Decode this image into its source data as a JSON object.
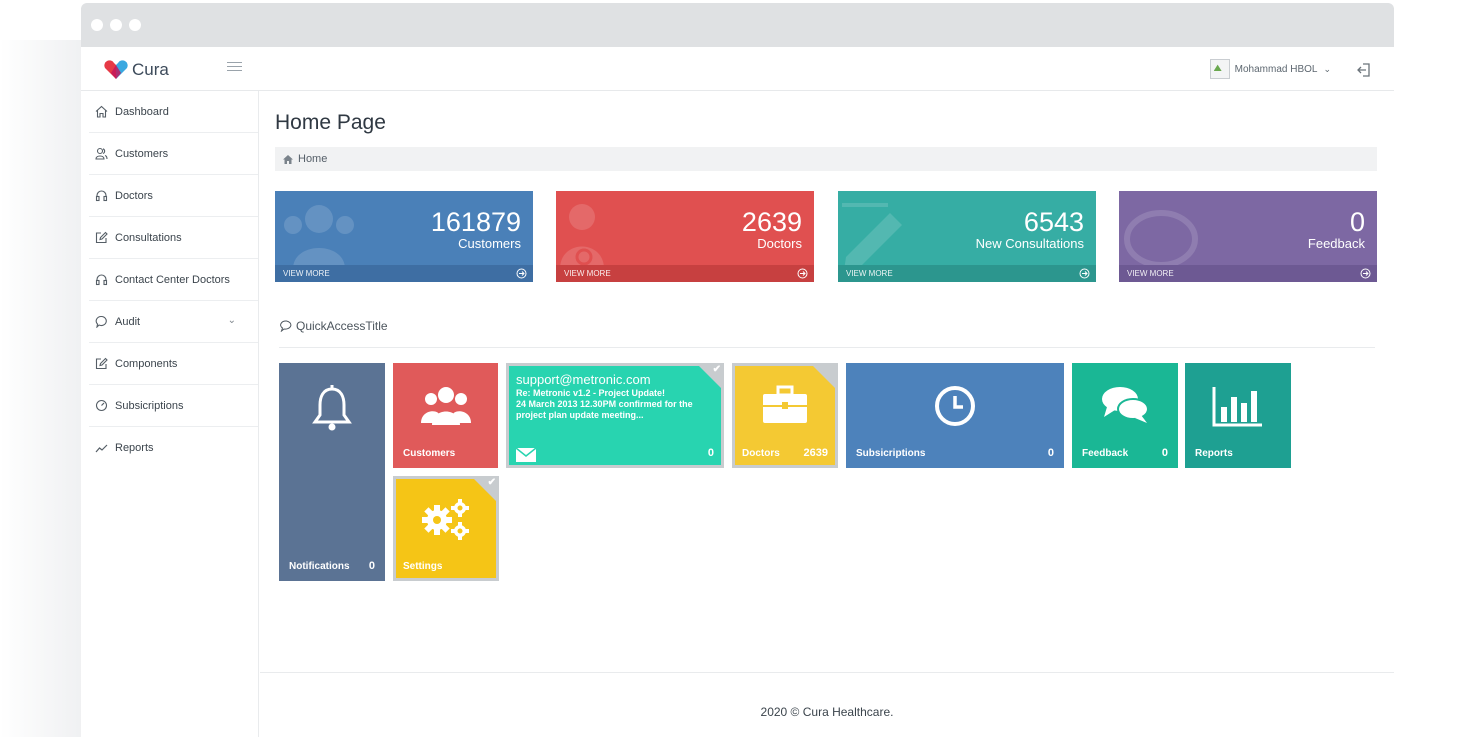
{
  "app": {
    "name": "Cura"
  },
  "header": {
    "user_name": "Mohammad HBOL"
  },
  "sidebar": {
    "items": [
      {
        "label": "Dashboard",
        "icon": "home-icon"
      },
      {
        "label": "Customers",
        "icon": "users-icon"
      },
      {
        "label": "Doctors",
        "icon": "headset-icon"
      },
      {
        "label": "Consultations",
        "icon": "edit-icon"
      },
      {
        "label": "Contact Center Doctors",
        "icon": "headset-icon"
      },
      {
        "label": "Audit",
        "icon": "chat-icon",
        "has_submenu": true
      },
      {
        "label": "Components",
        "icon": "edit-icon"
      },
      {
        "label": "Subsicriptions",
        "icon": "gauge-icon"
      },
      {
        "label": "Reports",
        "icon": "chart-line-icon"
      }
    ]
  },
  "page": {
    "title": "Home Page",
    "breadcrumb": "Home"
  },
  "stats": [
    {
      "value": "161879",
      "label": "Customers",
      "footer": "VIEW MORE",
      "color": "#4a80b8",
      "footer_color": "#3e6ea3"
    },
    {
      "value": "2639",
      "label": "Doctors",
      "footer": "VIEW MORE",
      "color": "#e05050",
      "footer_color": "#c74040"
    },
    {
      "value": "6543",
      "label": "New Consultations",
      "footer": "VIEW MORE",
      "color": "#36ada4",
      "footer_color": "#2c968e"
    },
    {
      "value": "0",
      "label": "Feedback",
      "footer": "VIEW MORE",
      "color": "#7d68a3",
      "footer_color": "#6d5993"
    }
  ],
  "quick_access": {
    "title": "QuickAccessTitle",
    "tiles": {
      "notifications": {
        "label": "Notifications",
        "count": "0",
        "color": "#5b7394"
      },
      "customers": {
        "label": "Customers",
        "color": "#e05a5a"
      },
      "mail": {
        "from": "support@metronic.com",
        "subject": "Re: Metronic v1.2 - Project Update!",
        "body": "24 March 2013 12.30PM confirmed for the project plan update meeting...",
        "count": "0",
        "color": "#28d4b0"
      },
      "doctors": {
        "label": "Doctors",
        "count": "2639",
        "color": "#f4c933"
      },
      "subscriptions": {
        "label": "Subsicriptions",
        "count": "0",
        "color": "#4d82bb"
      },
      "feedback": {
        "label": "Feedback",
        "count": "0",
        "color": "#1ab795"
      },
      "reports": {
        "label": "Reports",
        "color": "#1ea092"
      },
      "settings": {
        "label": "Settings",
        "color": "#f5c516"
      }
    }
  },
  "footer": {
    "text": "2020 © Cura Healthcare."
  }
}
